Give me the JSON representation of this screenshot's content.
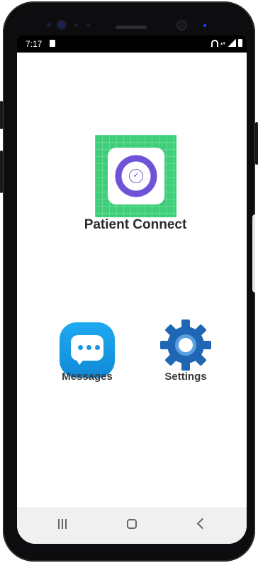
{
  "status_bar": {
    "time": "7:17",
    "icons": [
      "sim-card-icon",
      "wifi-icon",
      "lte-icon",
      "signal-icon",
      "battery-icon"
    ]
  },
  "home_screen": {
    "apps": [
      {
        "id": "patient-connect",
        "label": "Patient Connect",
        "icon": "patient-connect-icon",
        "colors": {
          "bg": "#3fcf7a",
          "ring": "#6e52d8"
        }
      },
      {
        "id": "messages",
        "label": "Messages",
        "icon": "messages-icon",
        "colors": {
          "bg": "#1eaaf1"
        }
      },
      {
        "id": "settings",
        "label": "Settings",
        "icon": "gear-icon",
        "colors": {
          "bg": "#1f67b4"
        }
      }
    ]
  },
  "nav_bar": {
    "buttons": [
      "recents-icon",
      "home-icon",
      "back-icon"
    ]
  }
}
